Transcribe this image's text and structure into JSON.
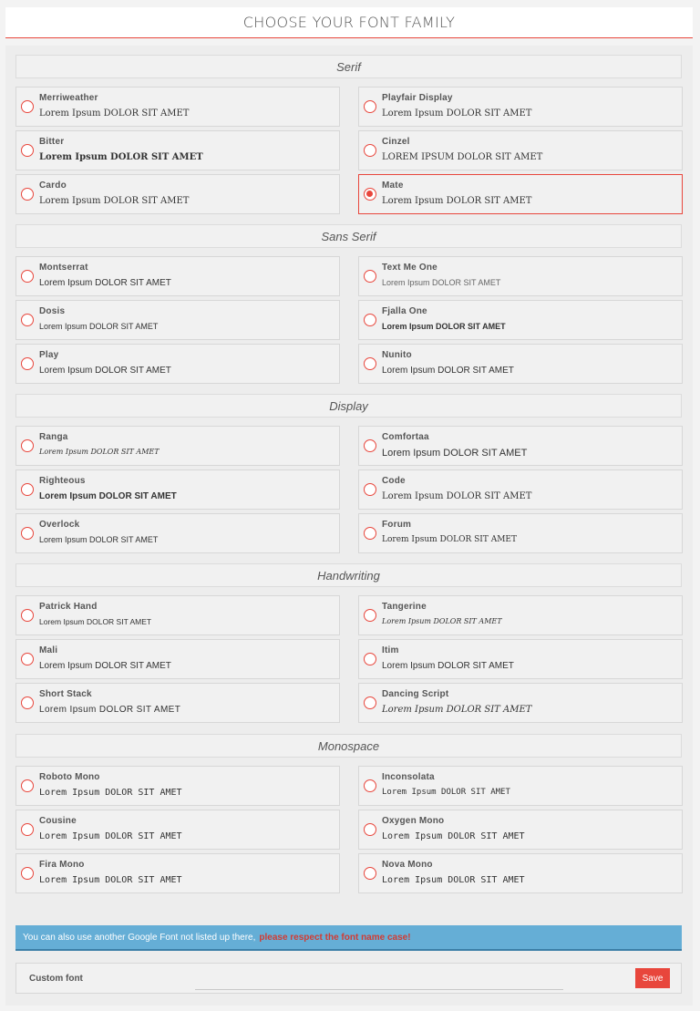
{
  "header": {
    "title": "CHOOSE YOUR FONT FAMILY"
  },
  "colors": {
    "accent": "#e8463c",
    "info_bg": "#65aed6",
    "info_highlight": "#d23b33"
  },
  "sections": [
    {
      "title": "Serif",
      "items": [
        {
          "name": "Merriweather",
          "sample": "Lorem Ipsum DOLOR SIT AMET",
          "checked": false
        },
        {
          "name": "Playfair Display",
          "sample": "Lorem Ipsum DOLOR SIT AMET",
          "checked": false
        },
        {
          "name": "Bitter",
          "sample": "Lorem Ipsum DOLOR SIT AMET",
          "checked": false
        },
        {
          "name": "Cinzel",
          "sample": "LOREM IPSUM DOLOR SIT AMET",
          "checked": false
        },
        {
          "name": "Cardo",
          "sample": "Lorem Ipsum DOLOR SIT AMET",
          "checked": false
        },
        {
          "name": "Mate",
          "sample": "Lorem Ipsum DOLOR SIT AMET",
          "checked": true
        }
      ]
    },
    {
      "title": "Sans Serif",
      "items": [
        {
          "name": "Montserrat",
          "sample": "Lorem Ipsum DOLOR SIT AMET",
          "checked": false
        },
        {
          "name": "Text Me One",
          "sample": "Lorem Ipsum DOLOR SIT AMET",
          "checked": false
        },
        {
          "name": "Dosis",
          "sample": "Lorem Ipsum DOLOR SIT AMET",
          "checked": false
        },
        {
          "name": "Fjalla One",
          "sample": "Lorem Ipsum DOLOR SIT AMET",
          "checked": false
        },
        {
          "name": "Play",
          "sample": "Lorem Ipsum DOLOR SIT AMET",
          "checked": false
        },
        {
          "name": "Nunito",
          "sample": "Lorem Ipsum DOLOR SIT AMET",
          "checked": false
        }
      ]
    },
    {
      "title": "Display",
      "items": [
        {
          "name": "Ranga",
          "sample": "Lorem Ipsum DOLOR SIT AMET",
          "checked": false
        },
        {
          "name": "Comfortaa",
          "sample": "Lorem Ipsum DOLOR SIT AMET",
          "checked": false
        },
        {
          "name": "Righteous",
          "sample": "Lorem Ipsum DOLOR SIT AMET",
          "checked": false
        },
        {
          "name": "Code",
          "sample": "Lorem Ipsum DOLOR SIT AMET",
          "checked": false
        },
        {
          "name": "Overlock",
          "sample": "Lorem Ipsum DOLOR SIT AMET",
          "checked": false
        },
        {
          "name": "Forum",
          "sample": "Lorem Ipsum DOLOR SIT AMET",
          "checked": false
        }
      ]
    },
    {
      "title": "Handwriting",
      "items": [
        {
          "name": "Patrick Hand",
          "sample": "Lorem Ipsum DOLOR SIT AMET",
          "checked": false
        },
        {
          "name": "Tangerine",
          "sample": "Lorem Ipsum DOLOR SIT AMET",
          "checked": false
        },
        {
          "name": "Mali",
          "sample": "Lorem Ipsum DOLOR SIT AMET",
          "checked": false
        },
        {
          "name": "Itim",
          "sample": "Lorem Ipsum DOLOR SIT AMET",
          "checked": false
        },
        {
          "name": "Short Stack",
          "sample": "Lorem Ipsum DOLOR SIT AMET",
          "checked": false
        },
        {
          "name": "Dancing Script",
          "sample": "Lorem Ipsum DOLOR SIT AMET",
          "checked": false
        }
      ]
    },
    {
      "title": "Monospace",
      "items": [
        {
          "name": "Roboto Mono",
          "sample": "Lorem Ipsum DOLOR SIT AMET",
          "checked": false
        },
        {
          "name": "Inconsolata",
          "sample": "Lorem Ipsum DOLOR SIT AMET",
          "checked": false
        },
        {
          "name": "Cousine",
          "sample": "Lorem Ipsum DOLOR SIT AMET",
          "checked": false
        },
        {
          "name": "Oxygen Mono",
          "sample": "Lorem Ipsum DOLOR SIT AMET",
          "checked": false
        },
        {
          "name": "Fira Mono",
          "sample": "Lorem Ipsum DOLOR SIT AMET",
          "checked": false
        },
        {
          "name": "Nova Mono",
          "sample": "Lorem Ipsum DOLOR SIT AMET",
          "checked": false
        }
      ]
    }
  ],
  "info": {
    "text": "You can also use another Google Font not listed up there,",
    "highlight": "please respect the font name case!"
  },
  "custom": {
    "label": "Custom font",
    "value": "",
    "placeholder": "",
    "save_label": "Save"
  }
}
